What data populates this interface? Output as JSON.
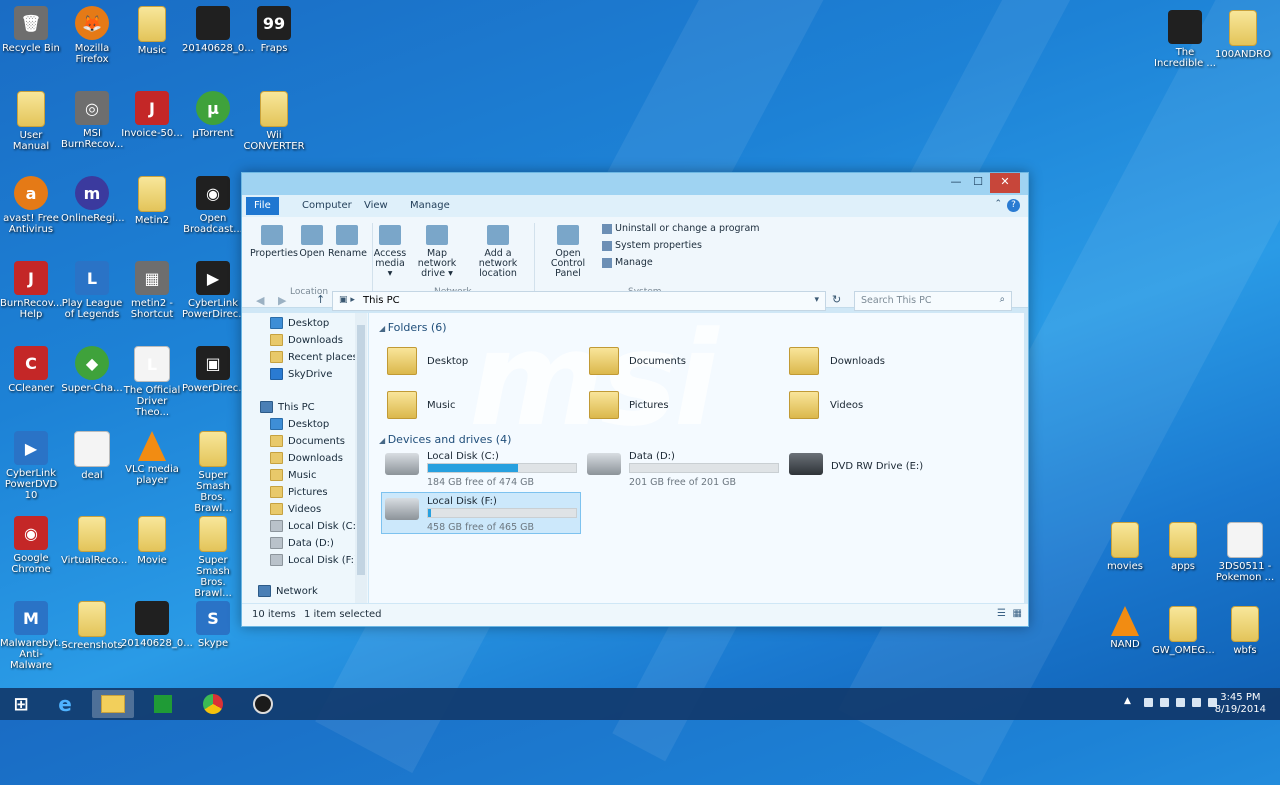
{
  "desktop": {
    "icons_left": [
      {
        "label": "Recycle Bin",
        "style": "i-gray",
        "glyph": "🗑"
      },
      {
        "label": "Mozilla Firefox",
        "style": "i-orange",
        "glyph": "🦊"
      },
      {
        "label": "Music",
        "style": "i-folder",
        "glyph": ""
      },
      {
        "label": "20140628_0...",
        "style": "i-dark",
        "glyph": ""
      },
      {
        "label": "Fraps",
        "style": "i-dark",
        "glyph": "99"
      },
      {
        "label": "User Manual",
        "style": "i-folder",
        "glyph": ""
      },
      {
        "label": "MSI BurnRecov...",
        "style": "i-gray",
        "glyph": "◎"
      },
      {
        "label": "Invoice-50...",
        "style": "i-red",
        "glyph": "J"
      },
      {
        "label": "µTorrent",
        "style": "i-green",
        "glyph": "µ"
      },
      {
        "label": "Wii CONVERTER",
        "style": "i-folder",
        "glyph": ""
      },
      {
        "label": "avast! Free Antivirus",
        "style": "i-orange",
        "glyph": "a"
      },
      {
        "label": "OnlineRegi...",
        "style": "i-purple",
        "glyph": "m"
      },
      {
        "label": "Metin2",
        "style": "i-folder",
        "glyph": ""
      },
      {
        "label": "Open Broadcast...",
        "style": "i-dark",
        "glyph": "◉"
      },
      {
        "label": "BurnRecov... Help",
        "style": "i-red",
        "glyph": "J"
      },
      {
        "label": "Play League of Legends",
        "style": "i-blue",
        "glyph": "L"
      },
      {
        "label": "metin2 - Shortcut",
        "style": "i-gray",
        "glyph": "▦"
      },
      {
        "label": "CyberLink PowerDirec...",
        "style": "i-dark",
        "glyph": "▶"
      },
      {
        "label": "CCleaner",
        "style": "i-red",
        "glyph": "C"
      },
      {
        "label": "Super-Cha...",
        "style": "i-green",
        "glyph": "◆"
      },
      {
        "label": "The Official Driver Theo...",
        "style": "i-white",
        "glyph": "L"
      },
      {
        "label": "PowerDirec...",
        "style": "i-dark",
        "glyph": "▣"
      },
      {
        "label": "CyberLink PowerDVD 10",
        "style": "i-blue",
        "glyph": "▶"
      },
      {
        "label": "deal",
        "style": "i-white",
        "glyph": ""
      },
      {
        "label": "VLC media player",
        "style": "i-cone",
        "glyph": ""
      },
      {
        "label": "Super Smash Bros. Brawl...",
        "style": "i-folder",
        "glyph": ""
      },
      {
        "label": "Google Chrome",
        "style": "i-red",
        "glyph": "◉"
      },
      {
        "label": "VirtualReco...",
        "style": "i-folder",
        "glyph": ""
      },
      {
        "label": "Movie",
        "style": "i-folder",
        "glyph": ""
      },
      {
        "label": "Super Smash Bros. Brawl...",
        "style": "i-folder",
        "glyph": ""
      },
      {
        "label": "Malwarebyt... Anti-Malware",
        "style": "i-blue",
        "glyph": "M"
      },
      {
        "label": "Screenshots",
        "style": "i-folder",
        "glyph": ""
      },
      {
        "label": "20140628_0...",
        "style": "i-dark",
        "glyph": ""
      },
      {
        "label": "Skype",
        "style": "i-blue",
        "glyph": "S"
      }
    ],
    "icons_right": [
      {
        "label": "The Incredible ...",
        "style": "i-dark",
        "glyph": ""
      },
      {
        "label": "100ANDRO",
        "style": "i-folder",
        "glyph": ""
      },
      {
        "label": "movies",
        "style": "i-folder",
        "glyph": ""
      },
      {
        "label": "apps",
        "style": "i-folder",
        "glyph": ""
      },
      {
        "label": "3DS0511 - Pokemon ...",
        "style": "i-white",
        "glyph": ""
      },
      {
        "label": "NAND",
        "style": "i-cone",
        "glyph": ""
      },
      {
        "label": "GW_OMEG...",
        "style": "i-folder",
        "glyph": ""
      },
      {
        "label": "wbfs",
        "style": "i-folder",
        "glyph": ""
      }
    ]
  },
  "explorer": {
    "window_controls": {
      "minimize": "—",
      "maximize": "☐",
      "close": "✕"
    },
    "tabs": [
      "File",
      "Computer",
      "View",
      "Manage"
    ],
    "ribbon": {
      "location": {
        "group_label": "Location",
        "buttons": [
          "Properties",
          "Open",
          "Rename"
        ]
      },
      "network": {
        "group_label": "Network",
        "buttons": [
          "Access media ▾",
          "Map network drive ▾",
          "Add a network location"
        ]
      },
      "system": {
        "group_label": "System",
        "open_control_panel": "Open Control Panel",
        "items": [
          "Uninstall or change a program",
          "System properties",
          "Manage"
        ]
      }
    },
    "address": {
      "path": "This PC",
      "search_placeholder": "Search This PC"
    },
    "nav_pane": {
      "favorites": [
        "Desktop",
        "Downloads",
        "Recent places",
        "SkyDrive"
      ],
      "this_pc": "This PC",
      "this_pc_items": [
        "Desktop",
        "Documents",
        "Downloads",
        "Music",
        "Pictures",
        "Videos",
        "Local Disk (C:)",
        "Data (D:)",
        "Local Disk (F:)"
      ],
      "network": "Network"
    },
    "watermark": "msi",
    "folders_header": "Folders (6)",
    "folders": [
      "Desktop",
      "Documents",
      "Downloads",
      "Music",
      "Pictures",
      "Videos"
    ],
    "devices_header": "Devices and drives (4)",
    "drives": [
      {
        "name": "Local Disk (C:)",
        "free": "184 GB free of 474 GB",
        "used_fraction": 0.61
      },
      {
        "name": "Data (D:)",
        "free": "201 GB free of 201 GB",
        "used_fraction": 0.0
      },
      {
        "name": "DVD RW Drive (E:)",
        "free": "",
        "used_fraction": null
      },
      {
        "name": "Local Disk (F:)",
        "free": "458 GB free of 465 GB",
        "used_fraction": 0.02
      }
    ],
    "status": {
      "items": "10 items",
      "selected": "1 item selected"
    }
  },
  "taskbar": {
    "time": "3:45 PM",
    "date": "8/19/2014"
  },
  "colors": {
    "accent": "#1f77d1",
    "close": "#c7463a",
    "drive_fill": "#27a0df"
  }
}
